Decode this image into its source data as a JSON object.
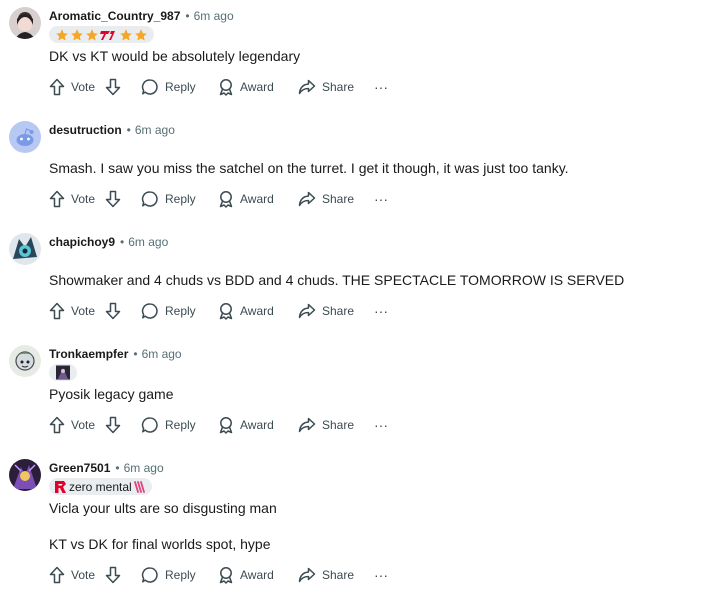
{
  "comments": [
    {
      "username": "Aromatic_Country_987",
      "time": "6m ago",
      "flair": {
        "kind": "stars",
        "stars": 5,
        "badge_icon": "t1-logo-icon"
      },
      "paragraphs": [
        "DK vs KT would be absolutely legendary"
      ]
    },
    {
      "username": "desutruction",
      "time": "6m ago",
      "flair": null,
      "paragraphs": [
        "Smash. I saw you miss the satchel on the turret. I get it though, it was just too tanky."
      ]
    },
    {
      "username": "chapichoy9",
      "time": "6m ago",
      "flair": null,
      "paragraphs": [
        "Showmaker and 4 chuds vs BDD and 4 chuds. THE SPECTACLE TOMORROW IS SERVED"
      ]
    },
    {
      "username": "Tronkaempfer",
      "time": "6m ago",
      "flair": {
        "kind": "icon",
        "icon": "champion-portrait-icon"
      },
      "paragraphs": [
        "Pyosik legacy game"
      ]
    },
    {
      "username": "Green7501",
      "time": "6m ago",
      "flair": {
        "kind": "text",
        "text": "zero mental",
        "prefix_icon": "rogue-logo-icon",
        "suffix_icon": "emote-icon"
      },
      "paragraphs": [
        "Vicla your ults are so disgusting man",
        "KT vs DK for final worlds spot, hype"
      ]
    }
  ],
  "actions": {
    "vote": "Vote",
    "reply": "Reply",
    "award": "Award",
    "share": "Share",
    "more": "···"
  },
  "colors": {
    "meta": "#576f76",
    "text": "#1a1a1b",
    "flair_bg": "#eaedef",
    "star": "#f5a623"
  }
}
